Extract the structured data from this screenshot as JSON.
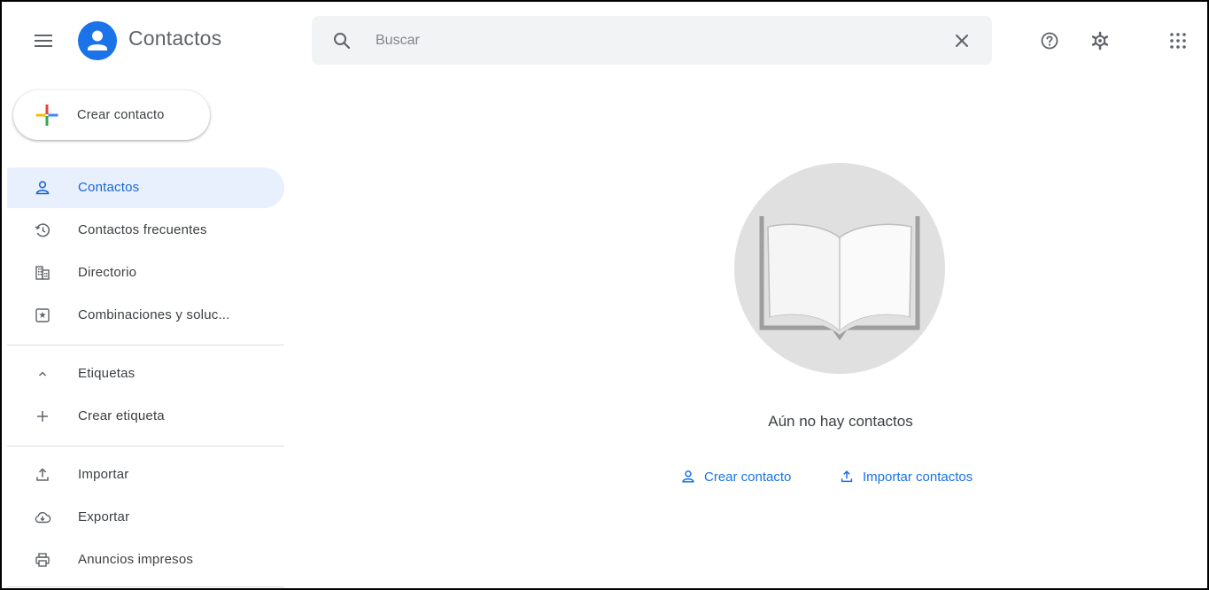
{
  "header": {
    "app_title": "Contactos",
    "search": {
      "placeholder": "Buscar",
      "value": ""
    },
    "icons": [
      "menu-icon",
      "help-icon",
      "settings-icon",
      "apps-icon",
      "search-icon",
      "close-icon"
    ]
  },
  "sidebar": {
    "create_button_label": "Crear contacto",
    "items": [
      {
        "label": "Contactos",
        "icon": "person-icon",
        "active": true
      },
      {
        "label": "Contactos frecuentes",
        "icon": "history-icon"
      },
      {
        "label": "Directorio",
        "icon": "domain-icon"
      },
      {
        "label": "Combinaciones y soluc...",
        "icon": "merge-icon"
      }
    ],
    "labels_section": {
      "label": "Etiquetas",
      "icon": "chevron-up-icon",
      "create_label": "Crear etiqueta"
    },
    "tools": [
      {
        "label": "Importar",
        "icon": "upload-icon"
      },
      {
        "label": "Exportar",
        "icon": "cloud-download-icon"
      },
      {
        "label": "Anuncios impresos",
        "icon": "print-icon"
      }
    ]
  },
  "main": {
    "empty_message": "Aún no hay contactos",
    "actions": {
      "create_contact": "Crear contacto",
      "import_contacts": "Importar contactos"
    }
  },
  "colors": {
    "accent": "#1a73e8",
    "active_bg": "#e8f0fe",
    "active_text": "#1967d2",
    "search_bg": "#f1f3f4",
    "illustration_circle": "#e0e0e0"
  }
}
